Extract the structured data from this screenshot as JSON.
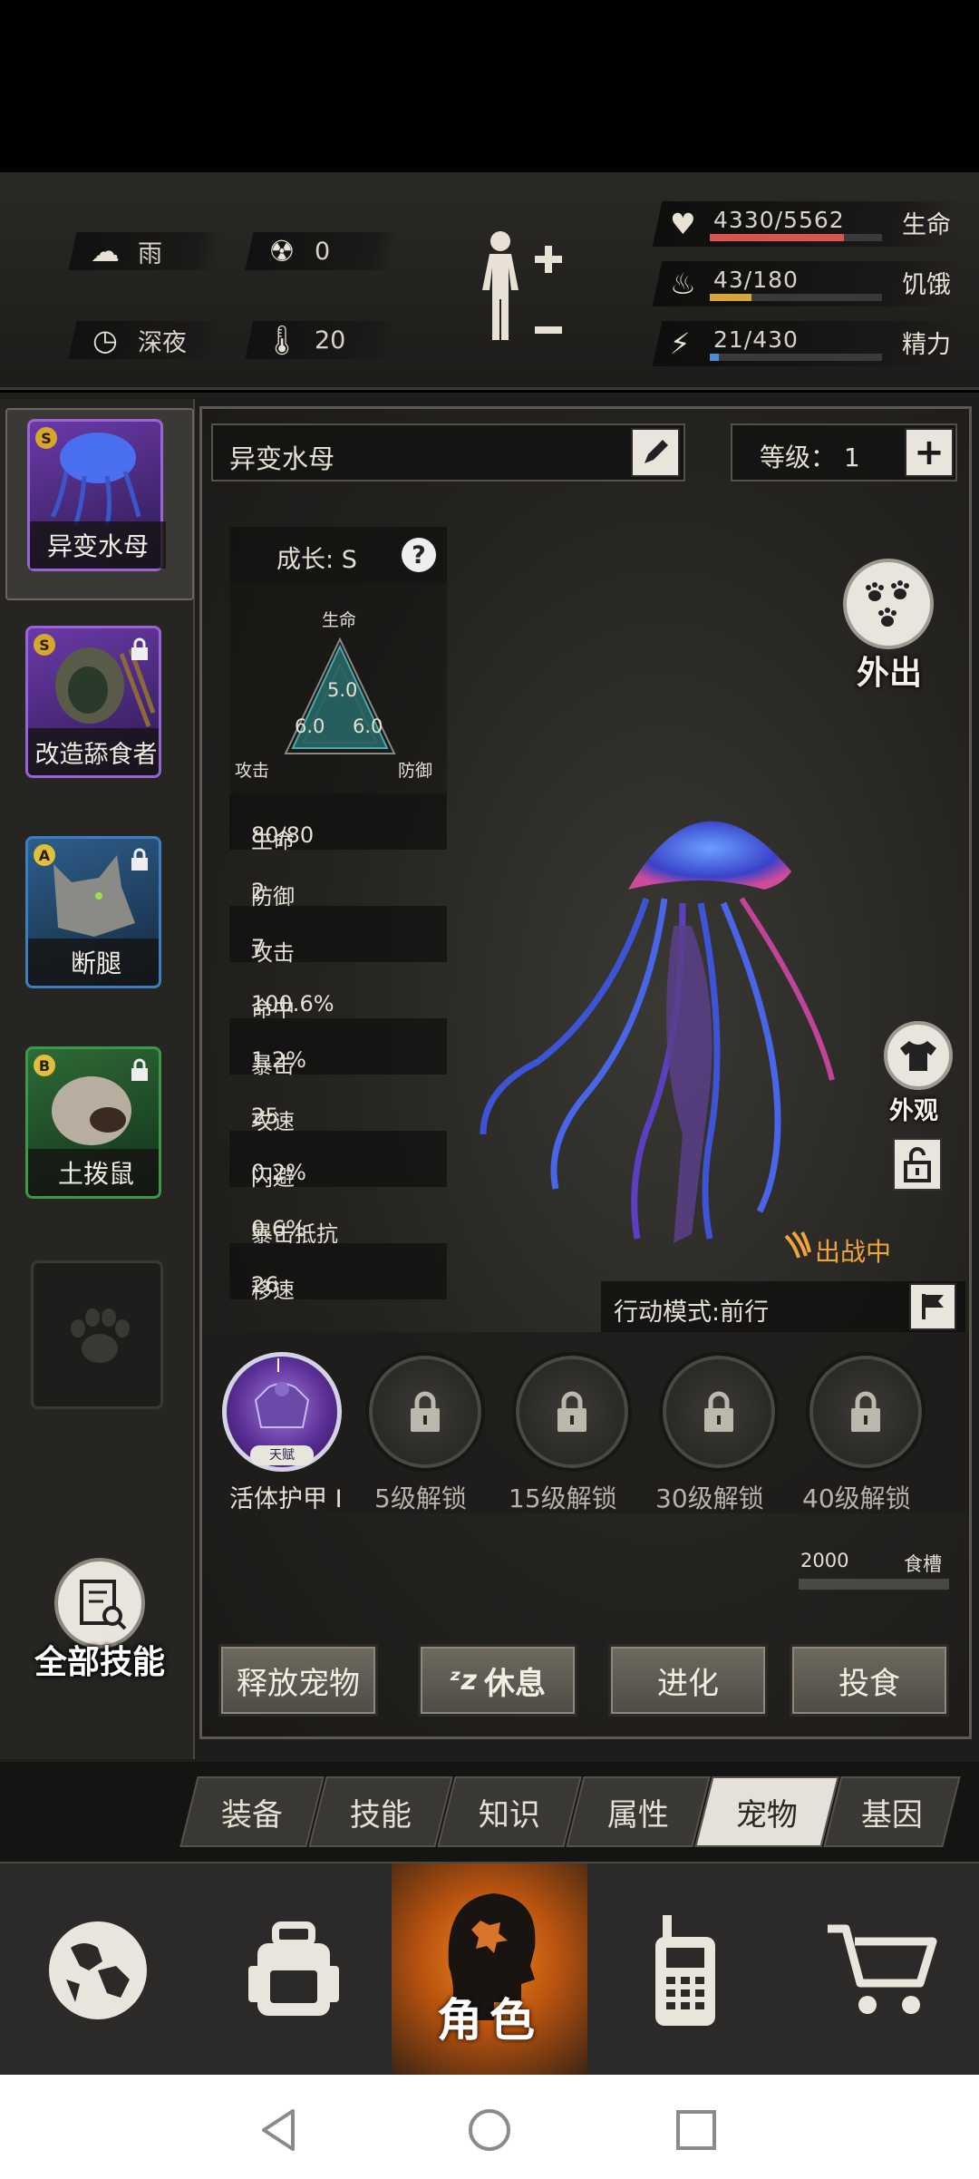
{
  "status": {
    "weather": {
      "icon": "rain-cloud-icon",
      "label": "雨"
    },
    "radiation": {
      "icon": "radiation-icon",
      "value": "0"
    },
    "time": {
      "icon": "clock-icon",
      "label": "深夜"
    },
    "temperature": {
      "icon": "thermometer-icon",
      "value": "20"
    },
    "body": {
      "icon": "body-figure-icon"
    },
    "vitals": [
      {
        "name": "生命",
        "value": "4330/5562",
        "fraction": 0.78,
        "color": "#d9534f",
        "icon": "heart-pulse-icon"
      },
      {
        "name": "饥饿",
        "value": "43/180",
        "fraction": 0.24,
        "color": "#d4a53a",
        "icon": "stomach-icon"
      },
      {
        "name": "精力",
        "value": "21/430",
        "fraction": 0.05,
        "color": "#4a8fd8",
        "icon": "energy-icon"
      }
    ]
  },
  "pets": [
    {
      "name": "异变水母",
      "grade": "S",
      "locked": false,
      "selected": true,
      "color": "#7b3fb0"
    },
    {
      "name": "改造舔食者",
      "grade": "S",
      "locked": true,
      "selected": false,
      "color": "#7b3fb0"
    },
    {
      "name": "断腿",
      "grade": "A",
      "locked": true,
      "selected": false,
      "color": "#2f6fa6"
    },
    {
      "name": "土拨鼠",
      "grade": "B",
      "locked": true,
      "selected": false,
      "color": "#2e7a3a"
    }
  ],
  "pet": {
    "name": "异变水母",
    "level_label": "等级：",
    "level": "1",
    "growth_label": "成长:",
    "growth": "S",
    "radar": {
      "top_label": "生命",
      "left_label": "攻击",
      "right_label": "防御",
      "top_value": "5.0",
      "left_value": "6.0",
      "right_value": "6.0"
    },
    "stats": [
      {
        "label": "生命",
        "value": "80/80"
      },
      {
        "label": "防御",
        "value": "2"
      },
      {
        "label": "攻击",
        "value": "7"
      },
      {
        "label": "命中",
        "value": "100.6%"
      },
      {
        "label": "暴击",
        "value": "1.2%"
      },
      {
        "label": "攻速",
        "value": "25"
      },
      {
        "label": "闪避",
        "value": "0.2%"
      },
      {
        "label": "暴击抵抗",
        "value": "0.6%"
      },
      {
        "label": "移速",
        "value": "26"
      }
    ],
    "go_out_label": "外出",
    "appearance_label": "外观",
    "battle_status": "出战中",
    "action_mode": "行动模式:前行",
    "skills": [
      {
        "label": "活体护甲 I",
        "badge": "天赋",
        "roman": "I"
      },
      {
        "label": "5级解锁"
      },
      {
        "label": "15级解锁"
      },
      {
        "label": "30级解锁"
      },
      {
        "label": "40级解锁"
      }
    ],
    "food_value": "2000",
    "food_label": "食槽",
    "all_skills_label": "全部技能",
    "buttons": {
      "release": "释放宠物",
      "rest": "休息",
      "evolve": "进化",
      "feed": "投食"
    }
  },
  "tabs": [
    "装备",
    "技能",
    "知识",
    "属性",
    "宠物",
    "基因"
  ],
  "active_tab": "宠物",
  "nav": {
    "items": [
      {
        "icon": "globe-icon"
      },
      {
        "icon": "backpack-icon"
      },
      {
        "icon": "character-head-icon",
        "label": "角色"
      },
      {
        "icon": "walkie-talkie-icon"
      },
      {
        "icon": "shopping-cart-icon"
      }
    ]
  }
}
